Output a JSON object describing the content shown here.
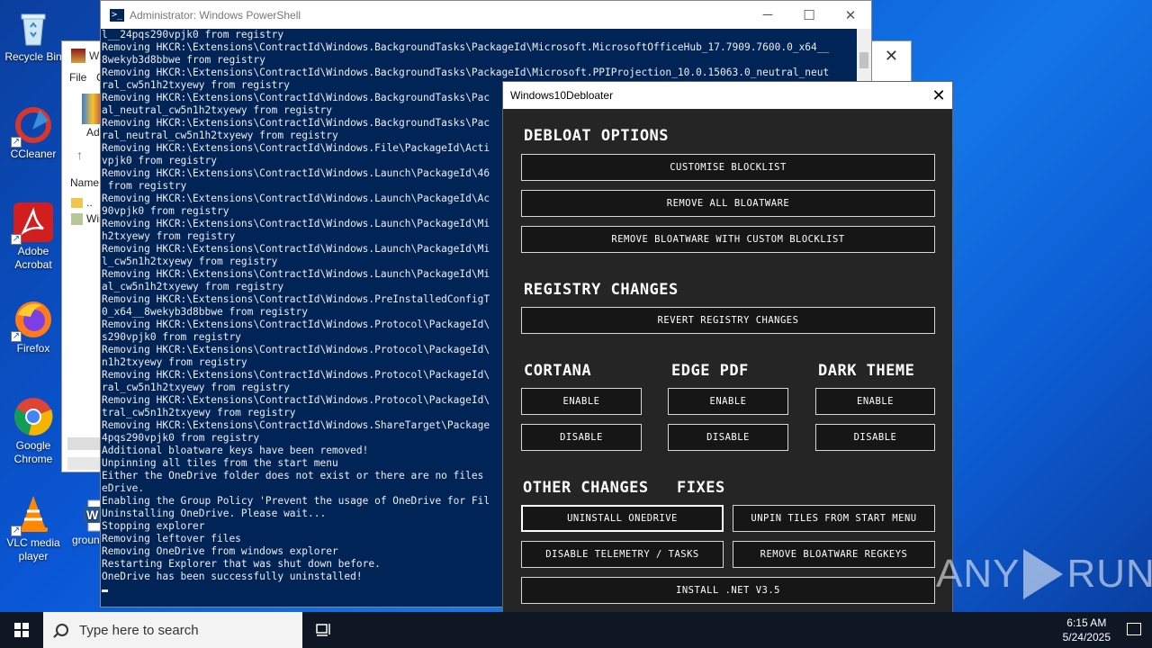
{
  "desktop": {
    "icons": [
      {
        "label": "Recycle Bin",
        "icon": "recycle-bin-icon"
      },
      {
        "label": "CCleaner",
        "icon": "ccleaner-icon"
      },
      {
        "label": "Adobe Acrobat",
        "icon": "acrobat-icon"
      },
      {
        "label": "Firefox",
        "icon": "firefox-icon"
      },
      {
        "label": "Google Chrome",
        "icon": "chrome-icon"
      },
      {
        "label": "VLC media player",
        "icon": "vlc-icon"
      },
      {
        "label": "groun",
        "icon": "word-icon"
      }
    ]
  },
  "explorer": {
    "title": "Wi",
    "menu_file": "File",
    "menu_c": "C",
    "ad_text": "Ad",
    "name_header": "Name",
    "row1": "..",
    "row2": "Win"
  },
  "powershell": {
    "title": "Administrator: Windows PowerShell",
    "icon_glyph": ">_",
    "lines": [
      "l__24pqs290vpjk0 from registry",
      "Removing HKCR:\\Extensions\\ContractId\\Windows.BackgroundTasks\\PackageId\\Microsoft.MicrosoftOfficeHub_17.7909.7600.0_x64__",
      "8wekyb3d8bbwe from registry",
      "Removing HKCR:\\Extensions\\ContractId\\Windows.BackgroundTasks\\PackageId\\Microsoft.PPIProjection_10.0.15063.0_neutral_neut",
      "ral_cw5n1h2txyewy from registry",
      "Removing HKCR:\\Extensions\\ContractId\\Windows.BackgroundTasks\\Pac",
      "al_neutral_cw5n1h2txyewy from registry",
      "Removing HKCR:\\Extensions\\ContractId\\Windows.BackgroundTasks\\Pac",
      "ral_neutral_cw5n1h2txyewy from registry",
      "Removing HKCR:\\Extensions\\ContractId\\Windows.File\\PackageId\\Acti",
      "vpjk0 from registry",
      "Removing HKCR:\\Extensions\\ContractId\\Windows.Launch\\PackageId\\46",
      " from registry",
      "Removing HKCR:\\Extensions\\ContractId\\Windows.Launch\\PackageId\\Ac",
      "90vpjk0 from registry",
      "Removing HKCR:\\Extensions\\ContractId\\Windows.Launch\\PackageId\\Mi",
      "h2txyewy from registry",
      "Removing HKCR:\\Extensions\\ContractId\\Windows.Launch\\PackageId\\Mi",
      "l_cw5n1h2txyewy from registry",
      "Removing HKCR:\\Extensions\\ContractId\\Windows.Launch\\PackageId\\Mi",
      "al_cw5n1h2txyewy from registry",
      "Removing HKCR:\\Extensions\\ContractId\\Windows.PreInstalledConfigT",
      "0_x64__8wekyb3d8bbwe from registry",
      "Removing HKCR:\\Extensions\\ContractId\\Windows.Protocol\\PackageId\\",
      "s290vpjk0 from registry",
      "Removing HKCR:\\Extensions\\ContractId\\Windows.Protocol\\PackageId\\",
      "n1h2txyewy from registry",
      "Removing HKCR:\\Extensions\\ContractId\\Windows.Protocol\\PackageId\\",
      "ral_cw5n1h2txyewy from registry",
      "Removing HKCR:\\Extensions\\ContractId\\Windows.Protocol\\PackageId\\",
      "tral_cw5n1h2txyewy from registry",
      "Removing HKCR:\\Extensions\\ContractId\\Windows.ShareTarget\\Package",
      "4pqs290vpjk0 from registry",
      "Additional bloatware keys have been removed!",
      "Unpinning all tiles from the start menu",
      "Either the OneDrive folder does not exist or there are no files",
      "eDrive.",
      "Enabling the Group Policy 'Prevent the usage of OneDrive for Fil",
      "Uninstalling OneDrive. Please wait...",
      "Stopping explorer",
      "Removing leftover files",
      "Removing OneDrive from windows explorer",
      "Restarting Explorer that was shut down before.",
      "OneDrive has been successfully uninstalled!"
    ]
  },
  "debloater": {
    "title": "Windows10Debloater",
    "sections": {
      "debloat": "DEBLOAT OPTIONS",
      "registry": "REGISTRY CHANGES",
      "cortana": "CORTANA",
      "edge_pdf": "EDGE PDF",
      "dark_theme": "DARK THEME",
      "other": "OTHER CHANGES",
      "fixes": "FIXES"
    },
    "buttons": {
      "customise_blocklist": "CUSTOMISE BLOCKLIST",
      "remove_all": "REMOVE ALL BLOATWARE",
      "remove_custom": "REMOVE BLOATWARE WITH CUSTOM BLOCKLIST",
      "revert_registry": "REVERT REGISTRY CHANGES",
      "cortana_enable": "ENABLE",
      "cortana_disable": "DISABLE",
      "edge_enable": "ENABLE",
      "edge_disable": "DISABLE",
      "dark_enable": "ENABLE",
      "dark_disable": "DISABLE",
      "uninstall_onedrive": "UNINSTALL ONEDRIVE",
      "unpin_tiles": "UNPIN TILES FROM START MENU",
      "disable_telemetry": "DISABLE TELEMETRY / TASKS",
      "remove_regkeys": "REMOVE BLOATWARE REGKEYS",
      "install_net": "INSTALL .NET V3.5"
    }
  },
  "watermark": {
    "left": "ANY",
    "right": "RUN"
  },
  "taskbar": {
    "search_placeholder": "Type here to search",
    "time": "6:15 AM",
    "date": "5/24/2025"
  }
}
